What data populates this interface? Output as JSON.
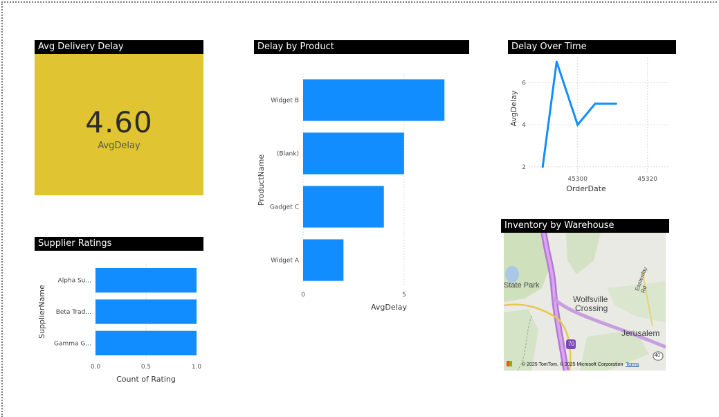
{
  "kpi": {
    "title": "Avg Delivery Delay",
    "value": "4.60",
    "label": "AvgDelay",
    "color": "#e0c432"
  },
  "supplier_chart": {
    "title": "Supplier Ratings"
  },
  "product_chart": {
    "title": "Delay by Product"
  },
  "time_chart": {
    "title": "Delay Over Time"
  },
  "map": {
    "title": "Inventory by Warehouse",
    "labels": {
      "state_park": "State Park",
      "wolfsville": "Wolfsville",
      "crossing": "Crossing",
      "jerusalem": "Jerusalem",
      "easterday": "Easterday Rd",
      "route_70": "70",
      "route_40": "40"
    },
    "credit": "© 2025 TomTom, © 2025 Microsoft Corporation",
    "terms": "Terms"
  },
  "bar_color": "#118dff",
  "chart_data": [
    {
      "id": "supplier",
      "type": "bar",
      "orientation": "horizontal",
      "title": "Supplier Ratings",
      "categories": [
        "Alpha Su...",
        "Beta Trad...",
        "Gamma G..."
      ],
      "values": [
        1,
        1,
        1
      ],
      "xlabel": "Count of Rating",
      "ylabel": "SupplierName",
      "xlim": [
        0,
        1
      ],
      "xticks": [
        "0.0",
        "0.5",
        "1.0"
      ],
      "grid": true
    },
    {
      "id": "product",
      "type": "bar",
      "orientation": "horizontal",
      "title": "Delay by Product",
      "categories": [
        "Widget B",
        "(Blank)",
        "Gadget C",
        "Widget A"
      ],
      "values": [
        7,
        5,
        4,
        2
      ],
      "xlabel": "AvgDelay",
      "ylabel": "ProductName",
      "xlim": [
        0,
        8.5
      ],
      "xticks": [
        "0",
        "5"
      ],
      "grid": true
    },
    {
      "id": "time",
      "type": "line",
      "title": "Delay Over Time",
      "x": [
        45290,
        45294,
        45300,
        45305,
        45311
      ],
      "y": [
        2,
        7,
        4,
        5,
        5
      ],
      "xlabel": "OrderDate",
      "ylabel": "AvgDelay",
      "xlim": [
        45286,
        45326
      ],
      "ylim": [
        1.7,
        7.2
      ],
      "xticks": [
        "45300",
        "45320"
      ],
      "yticks": [
        "2",
        "4",
        "6"
      ],
      "grid": true
    }
  ]
}
